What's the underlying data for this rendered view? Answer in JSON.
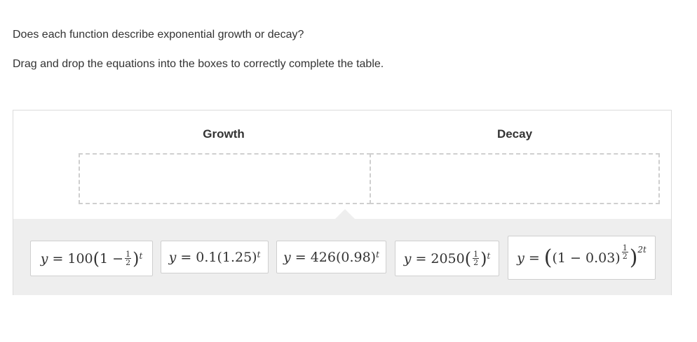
{
  "question": "Does each function describe exponential growth or decay?",
  "instruction": "Drag and drop the equations into the boxes to correctly complete the table.",
  "table": {
    "columns": [
      "Growth",
      "Decay"
    ]
  },
  "tiles": [
    {
      "lhs": "y",
      "eq": "=",
      "coef": "100",
      "open": "(",
      "inner": "1 − ",
      "frac_num": "1",
      "frac_den": "2",
      "close": ")",
      "exp": "t"
    },
    {
      "lhs": "y",
      "eq": "=",
      "coef": "0.1",
      "base": "(1.25)",
      "exp": "t"
    },
    {
      "lhs": "y",
      "eq": "=",
      "coef": "426",
      "base": "(0.98)",
      "exp": "t"
    },
    {
      "lhs": "y",
      "eq": "=",
      "coef": "2050",
      "open": "(",
      "frac_num": "1",
      "frac_den": "2",
      "close": ")",
      "exp": "t"
    },
    {
      "lhs": "y",
      "eq": "=",
      "outer_open": "(",
      "inner": "(1 − 0.03)",
      "inner_exp_num": "1",
      "inner_exp_den": "2",
      "outer_close": ")",
      "exp": "2t"
    }
  ]
}
